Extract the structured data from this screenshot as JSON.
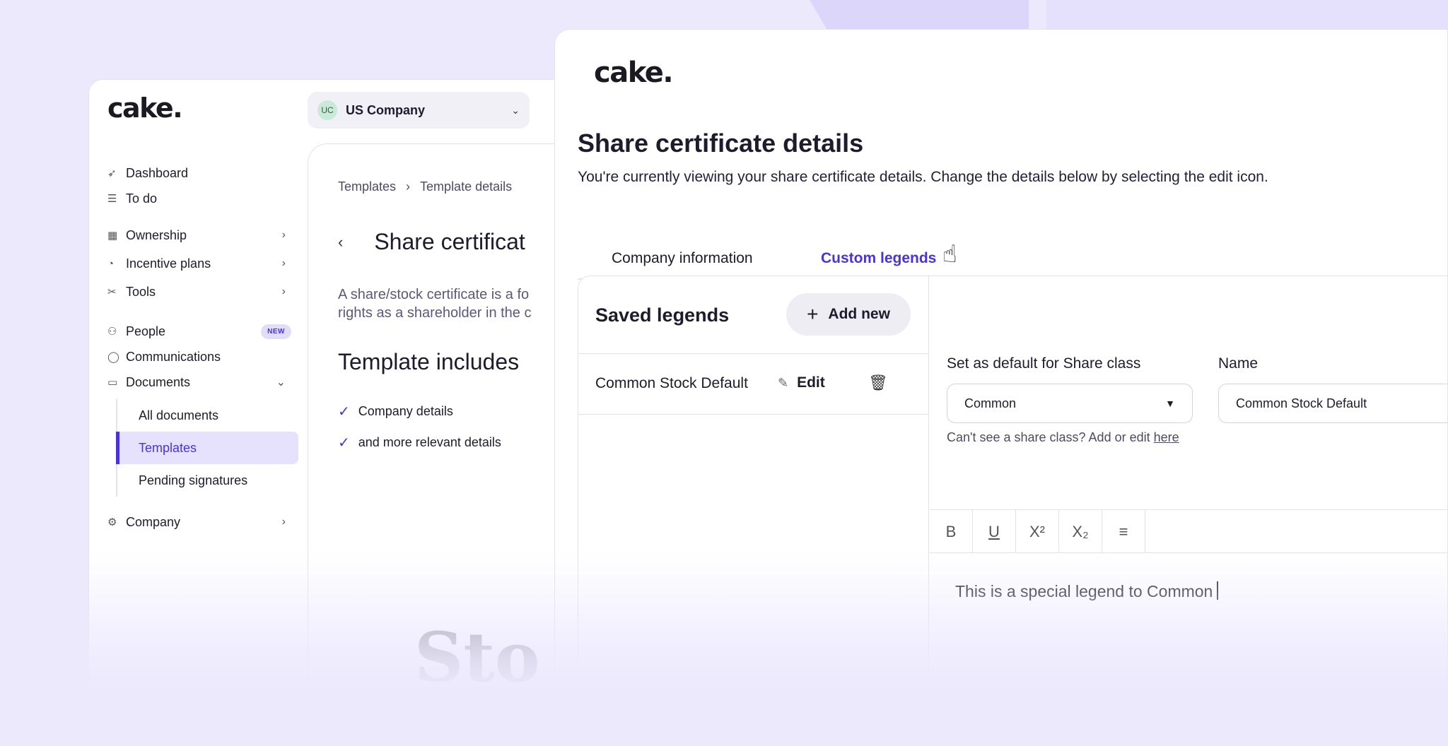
{
  "back_window": {
    "logo": "cake.",
    "company": {
      "badge": "UC",
      "name": "US Company"
    },
    "nav": {
      "dashboard": "Dashboard",
      "todo": "To do",
      "ownership": "Ownership",
      "incentive_plans": "Incentive plans",
      "tools": "Tools",
      "people": "People",
      "people_badge": "NEW",
      "communications": "Communications",
      "documents": "Documents",
      "all_documents": "All documents",
      "templates": "Templates",
      "pending_signatures": "Pending signatures",
      "company": "Company"
    },
    "breadcrumb": {
      "first": "Templates",
      "separator": "›",
      "second": "Template details"
    },
    "title": "Share certificat",
    "description_line1": "A share/stock certificate is a fo",
    "description_line2": "rights as a shareholder in the c",
    "template_includes": "Template includes",
    "includes": [
      "Company details",
      "and more relevant details"
    ],
    "preview_text": "Sto"
  },
  "front_window": {
    "logo": "cake.",
    "title": "Share certificate details",
    "subtitle": "You're currently viewing your share certificate details. Change the details below by selecting the edit icon.",
    "tabs": {
      "company_information": "Company information",
      "custom_legends": "Custom legends"
    },
    "saved_legends": {
      "title": "Saved legends",
      "add_new": "Add new",
      "items": [
        {
          "name": "Common Stock Default",
          "edit_label": "Edit"
        }
      ]
    },
    "form": {
      "share_class_label": "Set as default for Share class",
      "share_class_value": "Common",
      "name_label": "Name",
      "name_value": "Common Stock Default",
      "helper_text": "Can't see a share class? Add or edit ",
      "helper_link": "here"
    },
    "editor": {
      "toolbar": [
        "B",
        "U",
        "X²",
        "X₂",
        "≡"
      ],
      "content": "This is a special legend to Common"
    }
  },
  "colors": {
    "accent": "#4a33d9",
    "background": "#ece9fd",
    "badge_bg": "#e2dcfb"
  },
  "icons": [
    "rocket-icon",
    "checklist-icon",
    "table-icon",
    "pie-chart-icon",
    "tools-icon",
    "people-icon",
    "chat-icon",
    "folder-icon",
    "gear-icon",
    "chevron-right-icon",
    "chevron-down-icon",
    "check-icon",
    "plus-icon",
    "edit-icon",
    "trash-icon",
    "pointer-hand-icon"
  ]
}
